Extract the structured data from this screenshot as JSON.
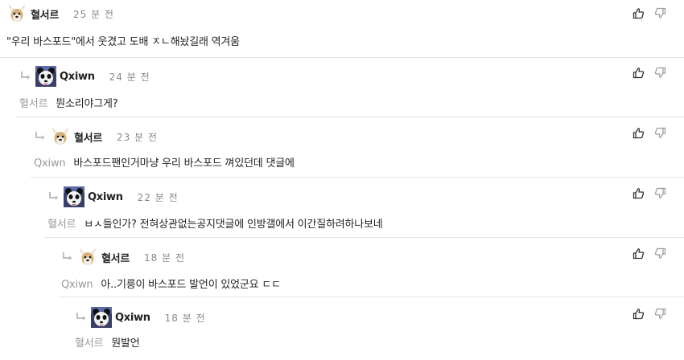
{
  "comments": [
    {
      "nick": "혈서르",
      "time": "25 분 전",
      "mention": "",
      "text": "\"우리 바스포드\"에서 웃겼고 도배 ㅈㄴ해놨길래 역겨움",
      "avatar": "dog"
    },
    {
      "nick": "Qxiwn",
      "time": "24 분 전",
      "mention": "혈서르",
      "text": "뭔소리야그게?",
      "avatar": "panda"
    },
    {
      "nick": "혈서르",
      "time": "23 분 전",
      "mention": "Qxiwn",
      "text": "바스포드팬인거마냥 우리 바스포드 껴있던데 댓글에",
      "avatar": "dog"
    },
    {
      "nick": "Qxiwn",
      "time": "22 분 전",
      "mention": "혈서르",
      "text": "ㅂㅅ들인가? 전혀상관없는공지댓글에 인방갤에서 이간질하려하나보네",
      "avatar": "panda"
    },
    {
      "nick": "혈서르",
      "time": "18 분 전",
      "mention": "Qxiwn",
      "text": "아..기릉이 바스포드 발언이 있었군요 ㄷㄷ",
      "avatar": "dog"
    },
    {
      "nick": "Qxiwn",
      "time": "18 분 전",
      "mention": "혈서르",
      "text": "뭔발언",
      "avatar": "panda"
    }
  ],
  "icons": {
    "reply": "reply-arrow-icon",
    "like": "thumbs-up-icon",
    "dislike": "thumbs-down-icon"
  },
  "colors": {
    "reply_arrow": "#bdbdbd",
    "mention": "#999999",
    "divider": "#e6e6e6"
  }
}
